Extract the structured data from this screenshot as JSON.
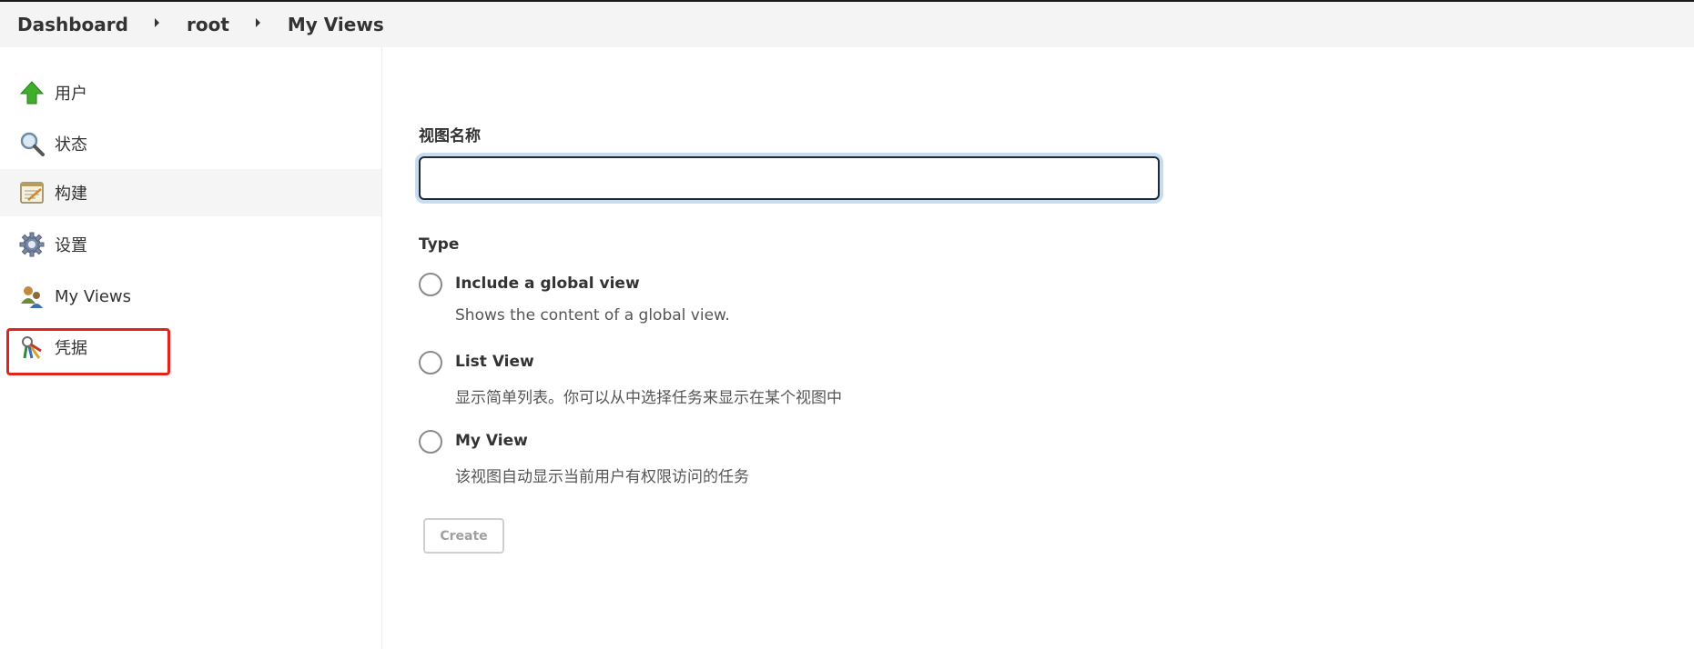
{
  "breadcrumb": {
    "items": [
      "Dashboard",
      "root",
      "My Views"
    ]
  },
  "sidebar": {
    "items": [
      {
        "label": "用户",
        "icon": "up-arrow-icon"
      },
      {
        "label": "状态",
        "icon": "magnifier-icon"
      },
      {
        "label": "构建",
        "icon": "notepad-icon"
      },
      {
        "label": "设置",
        "icon": "gear-icon"
      },
      {
        "label": "My Views",
        "icon": "users-icon"
      },
      {
        "label": "凭据",
        "icon": "keys-icon"
      }
    ],
    "active_index": 2,
    "highlighted_index": 5
  },
  "form": {
    "name_label": "视图名称",
    "name_value": "",
    "type_label": "Type",
    "options": [
      {
        "label": "Include a global view",
        "description": "Shows the content of a global view."
      },
      {
        "label": "List View",
        "description": "显示简单列表。你可以从中选择任务来显示在某个视图中"
      },
      {
        "label": "My View",
        "description": "该视图自动显示当前用户有权限访问的任务"
      }
    ],
    "create_label": "Create"
  },
  "colors": {
    "highlight": "#e5211c",
    "focus_ring": "#c7dcef",
    "breadcrumb_bg": "#f4f4f4"
  }
}
